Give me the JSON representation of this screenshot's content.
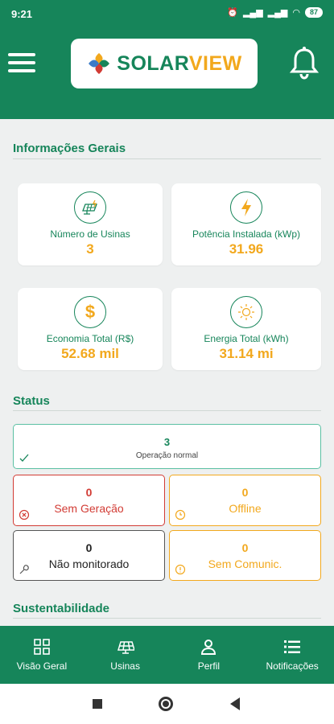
{
  "statusbar": {
    "time": "9:21",
    "battery": "87"
  },
  "brand": {
    "solar": "SOLAR",
    "view": "VIEW"
  },
  "sections": {
    "general": "Informações Gerais",
    "status": "Status",
    "sustainability": "Sustentabilidade"
  },
  "cards": [
    {
      "label": "Número de Usinas",
      "value": "3",
      "icon": "solar-panel-icon"
    },
    {
      "label": "Potência Instalada (kWp)",
      "value": "31.96",
      "icon": "lightning-icon"
    },
    {
      "label": "Economia Total (R$)",
      "value": "52.68 mil",
      "icon": "dollar-icon"
    },
    {
      "label": "Energia Total (kWh)",
      "value": "31.14 mi",
      "icon": "sun-icon"
    }
  ],
  "status": {
    "normal": {
      "count": "3",
      "label": "Operação normal"
    },
    "no_generation": {
      "count": "0",
      "label": "Sem Geração"
    },
    "offline": {
      "count": "0",
      "label": "Offline"
    },
    "not_monitored": {
      "count": "0",
      "label": "Não monitorado"
    },
    "no_comm": {
      "count": "0",
      "label": "Sem Comunic."
    }
  },
  "nav": [
    {
      "label": "Visão Geral",
      "icon": "grid-icon"
    },
    {
      "label": "Usinas",
      "icon": "solar-panel-icon"
    },
    {
      "label": "Perfil",
      "icon": "user-icon"
    },
    {
      "label": "Notificações",
      "icon": "list-icon"
    }
  ],
  "colors": {
    "primary": "#16855a",
    "accent": "#f2a81d",
    "error": "#d23b34",
    "neutral": "#555555"
  }
}
